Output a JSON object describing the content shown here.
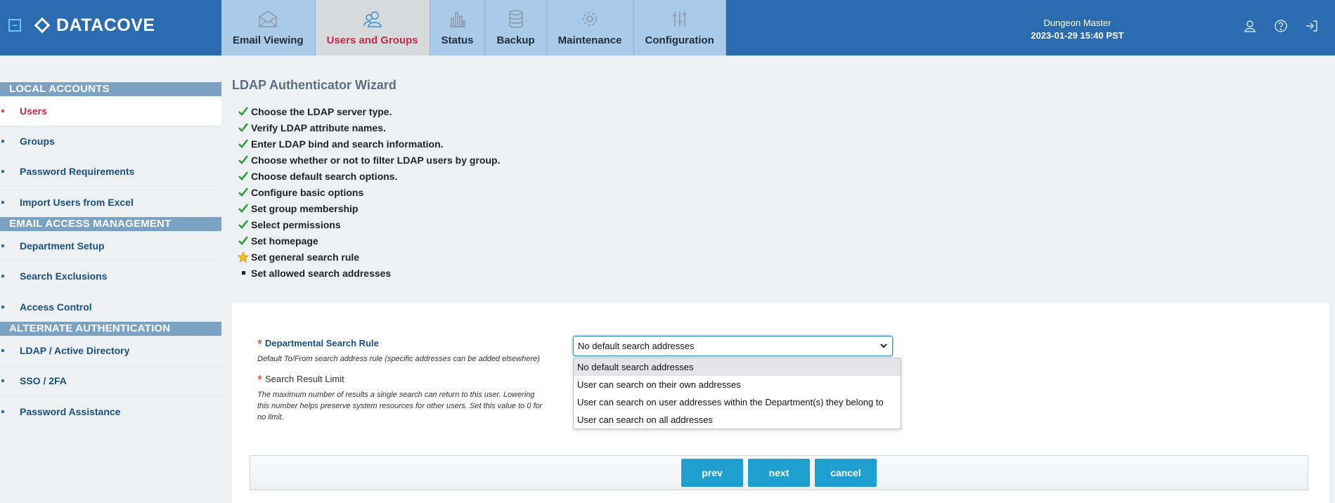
{
  "header": {
    "brand": "DATACOVE",
    "tabs": [
      {
        "label": "Email Viewing",
        "icon": "envelope-icon"
      },
      {
        "label": "Users and Groups",
        "icon": "users-icon"
      },
      {
        "label": "Status",
        "icon": "bar-chart-icon"
      },
      {
        "label": "Backup",
        "icon": "database-icon"
      },
      {
        "label": "Maintenance",
        "icon": "gear-icon"
      },
      {
        "label": "Configuration",
        "icon": "sliders-icon"
      }
    ],
    "user_name": "Dungeon Master",
    "datetime": "2023-01-29 15:40 PST",
    "icons": [
      "user-icon",
      "help-icon",
      "logout-icon"
    ],
    "colors": {
      "bar": "#2b6cb0",
      "tab": "#a9cbe9",
      "active_tab": "#d6dadd",
      "active_text": "#c8284a"
    }
  },
  "sidebar": {
    "sections": [
      {
        "title": "LOCAL ACCOUNTS",
        "items": [
          "Users",
          "Groups",
          "Password Requirements",
          "Import Users from Excel"
        ]
      },
      {
        "title": "EMAIL ACCESS MANAGEMENT",
        "items": [
          "Department Setup",
          "Search Exclusions",
          "Access Control"
        ]
      },
      {
        "title": "ALTERNATE AUTHENTICATION",
        "items": [
          "LDAP / Active Directory",
          "SSO / 2FA",
          "Password Assistance"
        ]
      }
    ],
    "active_item": "Users"
  },
  "wizard": {
    "title": "LDAP Authenticator Wizard",
    "steps": [
      {
        "label": "Choose the LDAP server type.",
        "status": "done"
      },
      {
        "label": "Verify LDAP attribute names.",
        "status": "done"
      },
      {
        "label": "Enter LDAP bind and search information.",
        "status": "done"
      },
      {
        "label": "Choose whether or not to filter LDAP users by group.",
        "status": "done"
      },
      {
        "label": "Choose default search options.",
        "status": "done"
      },
      {
        "label": "Configure basic options",
        "status": "done"
      },
      {
        "label": "Set group membership",
        "status": "done"
      },
      {
        "label": "Select permissions",
        "status": "done"
      },
      {
        "label": "Set homepage",
        "status": "done"
      },
      {
        "label": "Set general search rule",
        "status": "current"
      },
      {
        "label": "Set allowed search addresses",
        "status": "pending"
      }
    ]
  },
  "form": {
    "dept_rule": {
      "label": "Departmental Search Rule",
      "desc": "Default To/From search address rule (specific addresses can be added elsewhere)",
      "value": "No default search addresses",
      "options": [
        "No default search addresses",
        "User can search on their own addresses",
        "User can search on user addresses within the Department(s) they belong to",
        "User can search on all addresses"
      ]
    },
    "result_limit": {
      "label": "Search Result Limit",
      "desc_lines": [
        "The maximum number of results a single search can return to this user. Lowering",
        "this number helps preserve system resources for other users. Set this value to 0 for",
        "no limit."
      ]
    }
  },
  "buttons": {
    "prev": "prev",
    "next": "next",
    "cancel": "cancel"
  }
}
